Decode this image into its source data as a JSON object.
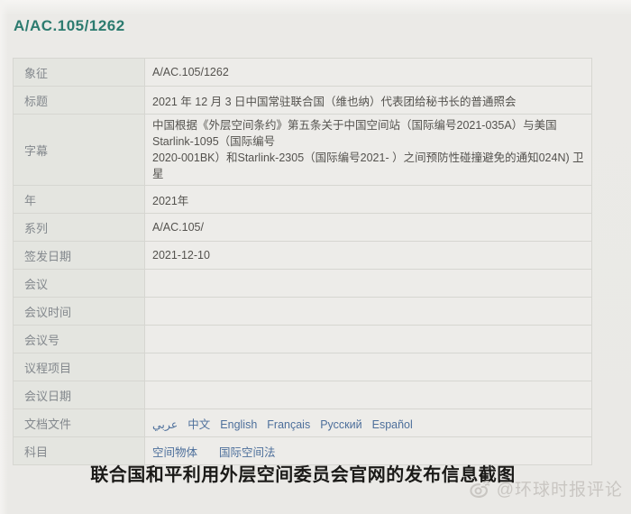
{
  "page": {
    "title": "A/AC.105/1262"
  },
  "table": {
    "rows": [
      {
        "label": "象征",
        "value": "A/AC.105/1262"
      },
      {
        "label": "标题",
        "value": "2021 年 12 月 3 日中国常驻联合国（维也纳）代表团给秘书长的普通照会"
      },
      {
        "label": "字幕",
        "value_lines": [
          "中国根据《外层空间条约》第五条关于中国空间站（国际编号2021-035A）与美国Starlink-1095（国际编号",
          "2020-001BK）和Starlink-2305（国际编号2021- ）之间预防性碰撞避免的通知024N) 卫星"
        ]
      },
      {
        "label": "年",
        "value": "2021年"
      },
      {
        "label": "系列",
        "value": "A/AC.105/"
      },
      {
        "label": "签发日期",
        "value": "2021-12-10"
      },
      {
        "label": "会议",
        "value": ""
      },
      {
        "label": "会议时间",
        "value": ""
      },
      {
        "label": "会议号",
        "value": ""
      },
      {
        "label": "议程项目",
        "value": ""
      },
      {
        "label": "会议日期",
        "value": ""
      },
      {
        "label": "文档文件",
        "link_type": "language-link",
        "links": [
          "عربي",
          "中文",
          "English",
          "Français",
          "Русский",
          "Español"
        ]
      },
      {
        "label": "科目",
        "link_type": "subject-link",
        "links": [
          "空间物体",
          "国际空间法"
        ]
      }
    ]
  },
  "caption": "联合国和平利用外层空间委员会官网的发布信息截图",
  "watermark": {
    "icon": "weibo-logo-icon",
    "handle": "@环球时报评论"
  },
  "colors": {
    "title_teal": "#2c7b6f",
    "link_blue": "#4d6f9b",
    "label_cell_bg": "#e4e5e0",
    "value_cell_bg": "#edece9",
    "table_border": "#c5c6c0",
    "background": "#eae9e6",
    "caption_text": "#1b1a18",
    "watermark_gray": "#c9c6c2"
  }
}
